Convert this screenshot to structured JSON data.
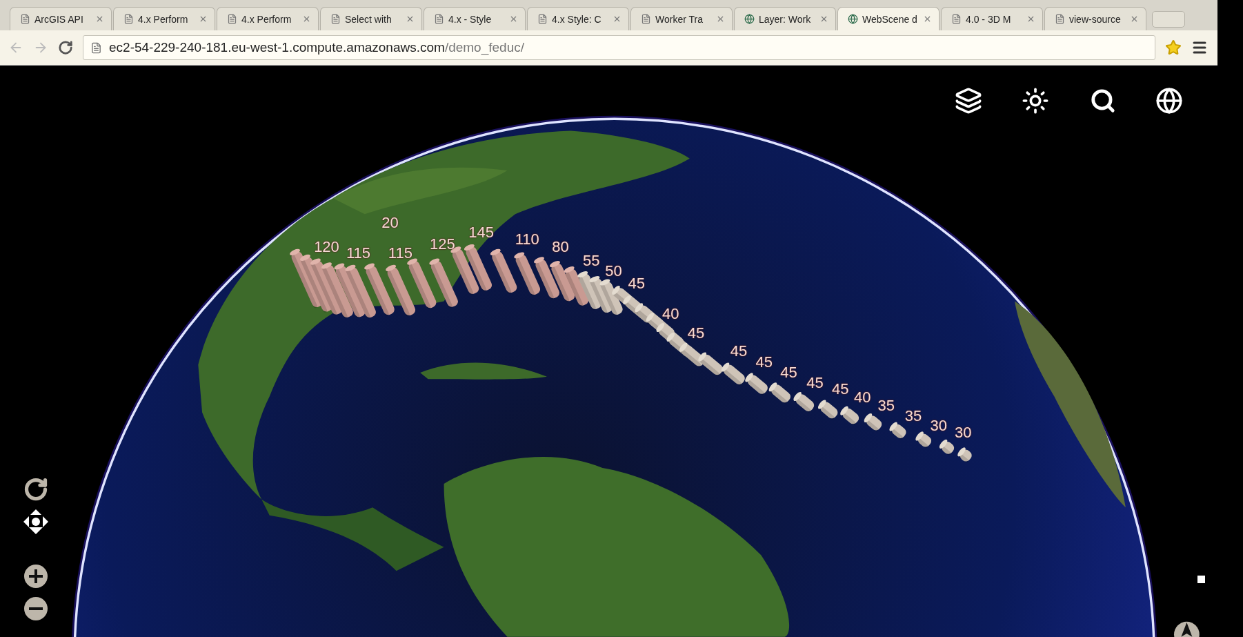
{
  "browser": {
    "tabs": [
      {
        "title": "ArcGIS API",
        "kind": "page",
        "selected": false
      },
      {
        "title": "4.x Perform",
        "kind": "page",
        "selected": false
      },
      {
        "title": "4.x Perform",
        "kind": "page",
        "selected": false
      },
      {
        "title": "Select with",
        "kind": "page",
        "selected": false
      },
      {
        "title": "4.x - Style",
        "kind": "page",
        "selected": false
      },
      {
        "title": "4.x Style: C",
        "kind": "page",
        "selected": false
      },
      {
        "title": "Worker Tra",
        "kind": "page",
        "selected": false
      },
      {
        "title": "Layer: Work",
        "kind": "site",
        "selected": false
      },
      {
        "title": "WebScene d",
        "kind": "site",
        "selected": true
      },
      {
        "title": "4.0 - 3D M",
        "kind": "page",
        "selected": false
      },
      {
        "title": "view-source",
        "kind": "page",
        "selected": false
      }
    ],
    "address": {
      "host": "ec2-54-229-240-181.eu-west-1.compute.amazonaws.com",
      "path": "/demo_feduc/"
    },
    "bookmarked": true
  },
  "map": {
    "labels": [
      "20",
      "120",
      "115",
      "115",
      "125",
      "145",
      "110",
      "80",
      "55",
      "50",
      "45",
      "40",
      "45",
      "45",
      "45",
      "45",
      "45",
      "45",
      "40",
      "35",
      "35",
      "30",
      "30"
    ]
  }
}
